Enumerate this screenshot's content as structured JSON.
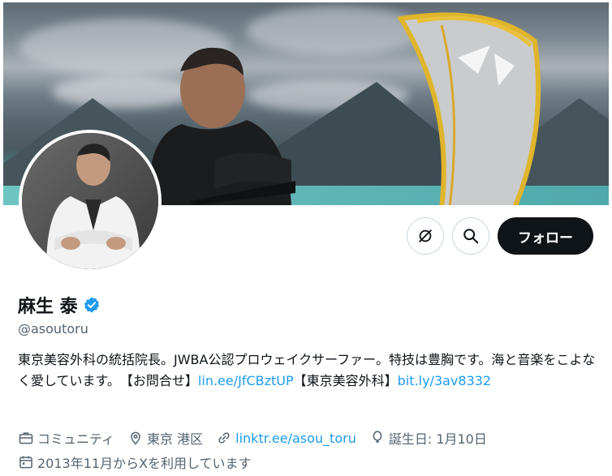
{
  "profile": {
    "name": "麻生 泰",
    "handle": "@asoutoru",
    "follow_label": "フォロー",
    "bio_text": "東京美容外科の統括院長。JWBA公認プロウェイクサーファー。特技は豊胸です。海と音楽をこよなく愛しています。　【お問合せ】",
    "bio_link1": "lin.ee/JfCBztUP",
    "bio_text2": "【東京美容外科】",
    "bio_link2": "bit.ly/3av8332"
  },
  "meta": {
    "category": "コミュニティ",
    "location": "東京 港区",
    "website": "linktr.ee/asou_toru",
    "birthday": "誕生日: 1月10日",
    "joined": "2013年11月からXを利用しています"
  },
  "icons": {
    "more": "grok-icon",
    "search": "search-icon",
    "verified": "verified-badge-icon",
    "category": "briefcase-icon",
    "location": "location-pin-icon",
    "website": "link-icon",
    "birthday": "balloon-icon",
    "joined": "calendar-icon"
  },
  "colors": {
    "accent": "#1d9bf0",
    "text": "#0f1419",
    "secondary": "#536471",
    "follow_bg": "#0f1419"
  }
}
